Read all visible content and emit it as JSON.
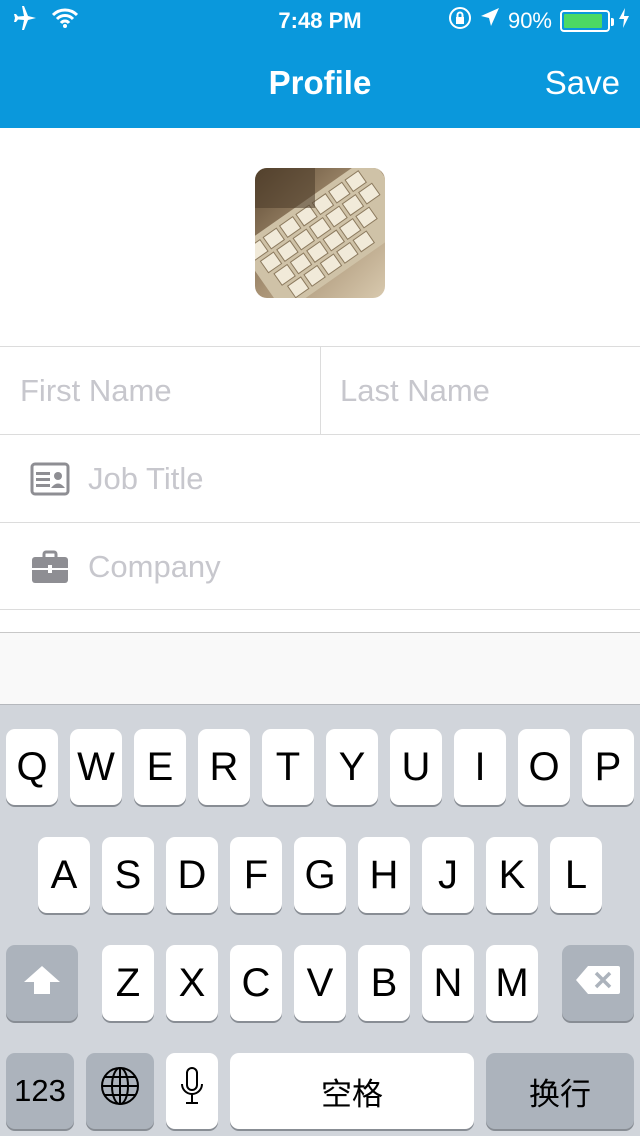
{
  "status_bar": {
    "time": "7:48 PM",
    "battery_text": "90%",
    "battery_level": 0.9,
    "icons": [
      "airplane-icon",
      "wifi-icon",
      "orientation-lock-icon",
      "location-icon",
      "battery-icon",
      "charging-icon"
    ]
  },
  "nav": {
    "title": "Profile",
    "save_label": "Save",
    "background": "#0a98dc"
  },
  "form": {
    "first_name_placeholder": "First Name",
    "last_name_placeholder": "Last Name",
    "job_title_placeholder": "Job Title",
    "company_placeholder": "Company"
  },
  "keyboard": {
    "row1": [
      "Q",
      "W",
      "E",
      "R",
      "T",
      "Y",
      "U",
      "I",
      "O",
      "P"
    ],
    "row2": [
      "A",
      "S",
      "D",
      "F",
      "G",
      "H",
      "J",
      "K",
      "L"
    ],
    "row3": [
      "Z",
      "X",
      "C",
      "V",
      "B",
      "N",
      "M"
    ],
    "numbers_label": "123",
    "space_label": "空格",
    "return_label": "换行"
  }
}
